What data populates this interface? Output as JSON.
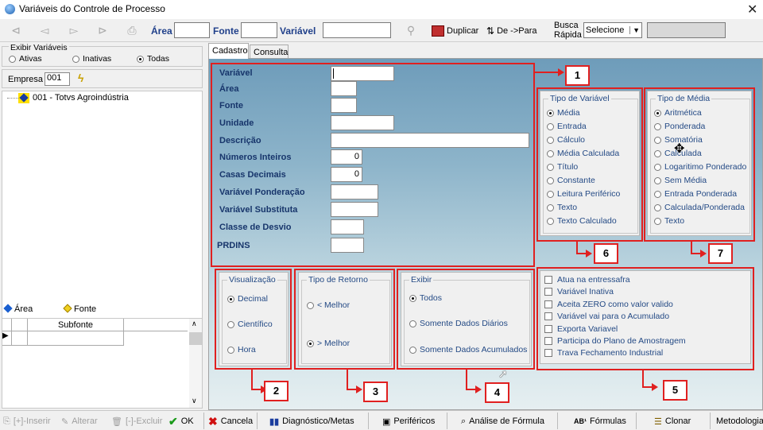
{
  "window": {
    "title": "Variáveis do Controle de Processo",
    "close": "✕"
  },
  "toolbar": {
    "area_label": "Área",
    "fonte_label": "Fonte",
    "variavel_label": "Variável",
    "duplicar": "Duplicar",
    "depara": "De ->Para",
    "busca_rapida_line1": "Busca",
    "busca_rapida_line2": "Rápida",
    "busca_select": "Selecione"
  },
  "left": {
    "exibir_title": "Exibir Variáveis",
    "opt_ativas": "Ativas",
    "opt_inativas": "Inativas",
    "opt_todas": "Todas",
    "empresa_label": "Empresa",
    "empresa_value": "001",
    "tree_item": "001 - Totvs Agroindústria",
    "legend_area": "Área",
    "legend_fonte": "Fonte",
    "subfonte_header": "Subfonte"
  },
  "tabs": [
    "Cadastro",
    "Consulta"
  ],
  "form": {
    "variavel": "Variável",
    "area": "Área",
    "fonte": "Fonte",
    "unidade": "Unidade",
    "descricao": "Descrição",
    "numeros_inteiros": "Números Inteiros",
    "numeros_inteiros_value": "0",
    "casas_decimais": "Casas Decimais",
    "casas_decimais_value": "0",
    "var_ponderacao": "Variável  Ponderação",
    "var_substituta": "Variável  Substituta",
    "classe_desvio": "Classe de Desvio",
    "prdins": "PRDINS"
  },
  "tipo_variavel": {
    "title": "Tipo de Variável",
    "options": [
      "Média",
      "Entrada",
      "Cálculo",
      "Média Calculada",
      "Título",
      "Constante",
      "Leitura Periférico",
      "Texto",
      "Texto Calculado"
    ]
  },
  "tipo_media": {
    "title": "Tipo de Média",
    "options": [
      "Aritmética",
      "Ponderada",
      "Somatória",
      "Calculada",
      "Logaritimo Ponderado",
      "Sem Média",
      "Entrada Ponderada",
      "Calculada/Ponderada",
      "Texto"
    ]
  },
  "visualizacao": {
    "title": "Visualização",
    "options": [
      "Decimal",
      "Científico",
      "Hora"
    ]
  },
  "tipo_retorno": {
    "title": "Tipo de Retorno",
    "options": [
      "< Melhor",
      "> Melhor"
    ]
  },
  "exibir": {
    "title": "Exibir",
    "options": [
      "Todos",
      "Somente Dados Diários",
      "Somente Dados Acumulados"
    ]
  },
  "checks": [
    "Atua na entressafra",
    "Variável Inativa",
    "Aceita ZERO como valor valido",
    "Variável vai para o Acumulado",
    "Exporta Variavel",
    "Participa do Plano de Amostragem",
    "Trava Fechamento Industrial"
  ],
  "badges": [
    "1",
    "2",
    "3",
    "4",
    "5",
    "6",
    "7"
  ],
  "bottom": {
    "inserir": "[+]-Inserir",
    "alterar": "Alterar",
    "excluir": "[-]-Excluir",
    "ok": "OK",
    "cancela": "Cancela",
    "diagnostico": "Diagnóstico/Metas",
    "perifericos": "Periféricos",
    "analise": "Análise de Fórmula",
    "formulas": "Fórmulas",
    "clonar": "Clonar",
    "metodologia": "Metodologia"
  }
}
